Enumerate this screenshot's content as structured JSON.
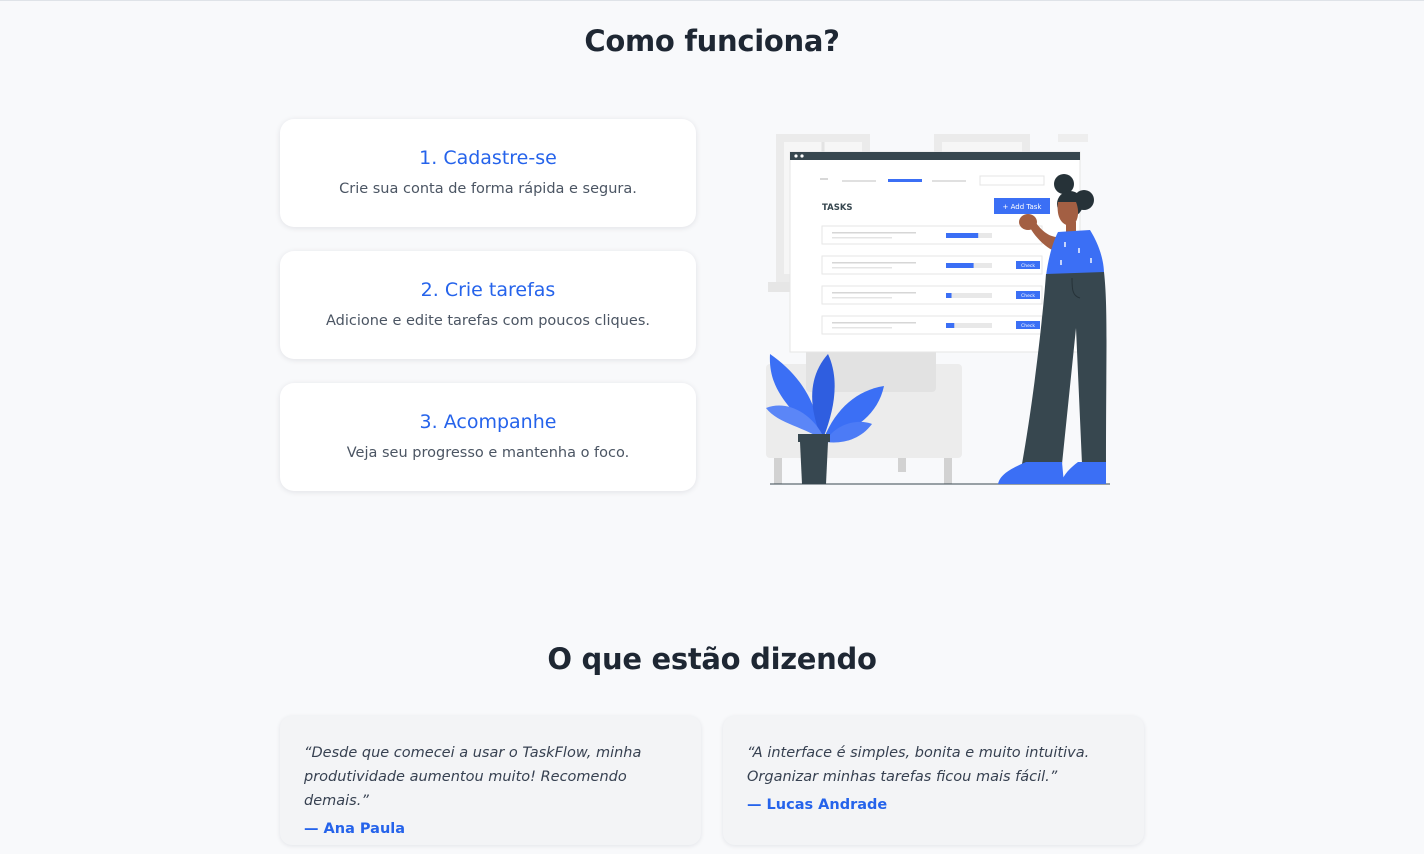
{
  "how_it_works": {
    "title": "Como funciona?",
    "steps": [
      {
        "title": "1. Cadastre-se",
        "description": "Crie sua conta de forma rápida e segura."
      },
      {
        "title": "2. Crie tarefas",
        "description": "Adicione e edite tarefas com poucos cliques."
      },
      {
        "title": "3. Acompanhe",
        "description": "Veja seu progresso e mantenha o foco."
      }
    ],
    "illustration": {
      "heading": "TASKS",
      "add_button": "+ Add Task",
      "row_button": "Check",
      "task_progress": [
        0.7,
        0.6,
        0.12,
        0.18
      ]
    }
  },
  "testimonials": {
    "title": "O que estão dizendo",
    "items": [
      {
        "quote": "“Desde que comecei a usar o TaskFlow, minha produtividade aumentou muito! Recomendo demais.”",
        "author": "— Ana Paula"
      },
      {
        "quote": "“A interface é simples, bonita e muito intuitiva. Organizar minhas tarefas ficou mais fácil.”",
        "author": "— Lucas Andrade"
      }
    ]
  },
  "colors": {
    "accent": "#2563eb",
    "illustration_blue": "#3b6ff5",
    "dark": "#37474f"
  }
}
